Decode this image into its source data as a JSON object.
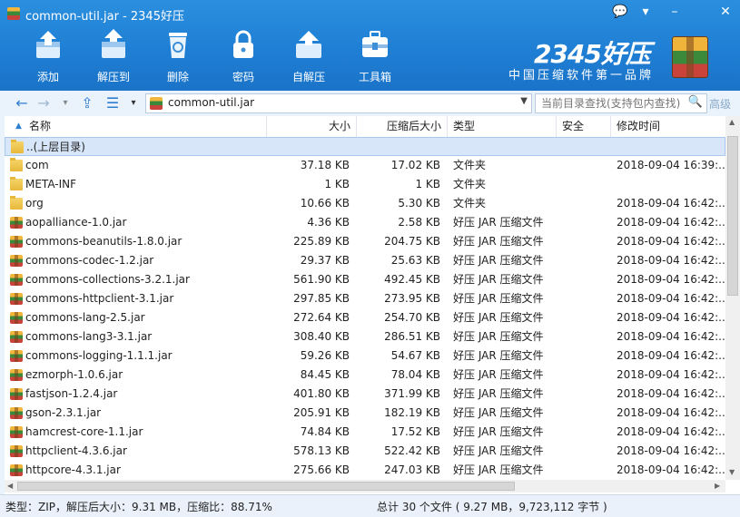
{
  "window": {
    "title": "common-util.jar - 2345好压",
    "controls": [
      "💬",
      "▾",
      "–",
      "✕"
    ]
  },
  "toolbar": [
    {
      "name": "add",
      "label": "添加"
    },
    {
      "name": "extract-to",
      "label": "解压到"
    },
    {
      "name": "delete",
      "label": "删除"
    },
    {
      "name": "password",
      "label": "密码"
    },
    {
      "name": "self-extract",
      "label": "自解压"
    },
    {
      "name": "toolbox",
      "label": "工具箱"
    }
  ],
  "brand": {
    "logo": "2345好压",
    "slogan": "中国压缩软件第一品牌"
  },
  "nav": {
    "path": "common-util.jar",
    "search_placeholder": "当前目录查找(支持包内查找)",
    "advanced": "高级"
  },
  "columns": {
    "name": "名称",
    "size": "大小",
    "packed": "压缩后大小",
    "type": "类型",
    "security": "安全",
    "modified": "修改时间"
  },
  "rows": [
    {
      "name": "..(上层目录)",
      "size": "",
      "packed": "",
      "type": "",
      "modified": "",
      "icon": "folder",
      "selected": true
    },
    {
      "name": "com",
      "size": "37.18 KB",
      "packed": "17.02 KB",
      "type": "文件夹",
      "modified": "2018-09-04 16:39:...",
      "icon": "folder"
    },
    {
      "name": "META-INF",
      "size": "1 KB",
      "packed": "1 KB",
      "type": "文件夹",
      "modified": "",
      "icon": "folder"
    },
    {
      "name": "org",
      "size": "10.66 KB",
      "packed": "5.30 KB",
      "type": "文件夹",
      "modified": "2018-09-04 16:42:...",
      "icon": "folder"
    },
    {
      "name": "aopalliance-1.0.jar",
      "size": "4.36 KB",
      "packed": "2.58 KB",
      "type": "好压 JAR 压缩文件",
      "modified": "2018-09-04 16:42:...",
      "icon": "jar"
    },
    {
      "name": "commons-beanutils-1.8.0.jar",
      "size": "225.89 KB",
      "packed": "204.75 KB",
      "type": "好压 JAR 压缩文件",
      "modified": "2018-09-04 16:42:...",
      "icon": "jar"
    },
    {
      "name": "commons-codec-1.2.jar",
      "size": "29.37 KB",
      "packed": "25.63 KB",
      "type": "好压 JAR 压缩文件",
      "modified": "2018-09-04 16:42:...",
      "icon": "jar"
    },
    {
      "name": "commons-collections-3.2.1.jar",
      "size": "561.90 KB",
      "packed": "492.45 KB",
      "type": "好压 JAR 压缩文件",
      "modified": "2018-09-04 16:42:...",
      "icon": "jar"
    },
    {
      "name": "commons-httpclient-3.1.jar",
      "size": "297.85 KB",
      "packed": "273.95 KB",
      "type": "好压 JAR 压缩文件",
      "modified": "2018-09-04 16:42:...",
      "icon": "jar"
    },
    {
      "name": "commons-lang-2.5.jar",
      "size": "272.64 KB",
      "packed": "254.70 KB",
      "type": "好压 JAR 压缩文件",
      "modified": "2018-09-04 16:42:...",
      "icon": "jar"
    },
    {
      "name": "commons-lang3-3.1.jar",
      "size": "308.40 KB",
      "packed": "286.51 KB",
      "type": "好压 JAR 压缩文件",
      "modified": "2018-09-04 16:42:...",
      "icon": "jar"
    },
    {
      "name": "commons-logging-1.1.1.jar",
      "size": "59.26 KB",
      "packed": "54.67 KB",
      "type": "好压 JAR 压缩文件",
      "modified": "2018-09-04 16:42:...",
      "icon": "jar"
    },
    {
      "name": "ezmorph-1.0.6.jar",
      "size": "84.45 KB",
      "packed": "78.04 KB",
      "type": "好压 JAR 压缩文件",
      "modified": "2018-09-04 16:42:...",
      "icon": "jar"
    },
    {
      "name": "fastjson-1.2.4.jar",
      "size": "401.80 KB",
      "packed": "371.99 KB",
      "type": "好压 JAR 压缩文件",
      "modified": "2018-09-04 16:42:...",
      "icon": "jar"
    },
    {
      "name": "gson-2.3.1.jar",
      "size": "205.91 KB",
      "packed": "182.19 KB",
      "type": "好压 JAR 压缩文件",
      "modified": "2018-09-04 16:42:...",
      "icon": "jar"
    },
    {
      "name": "hamcrest-core-1.1.jar",
      "size": "74.84 KB",
      "packed": "17.52 KB",
      "type": "好压 JAR 压缩文件",
      "modified": "2018-09-04 16:42:...",
      "icon": "jar"
    },
    {
      "name": "httpclient-4.3.6.jar",
      "size": "578.13 KB",
      "packed": "522.42 KB",
      "type": "好压 JAR 压缩文件",
      "modified": "2018-09-04 16:42:...",
      "icon": "jar"
    },
    {
      "name": "httpcore-4.3.1.jar",
      "size": "275.66 KB",
      "packed": "247.03 KB",
      "type": "好压 JAR 压缩文件",
      "modified": "2018-09-04 16:42:...",
      "icon": "jar"
    }
  ],
  "status": {
    "left": "类型：ZIP，解压后大小：9.31 MB，压缩比：88.71%",
    "right": "总计 30 个文件 ( 9.27 MB，9,723,112 字节 )"
  }
}
